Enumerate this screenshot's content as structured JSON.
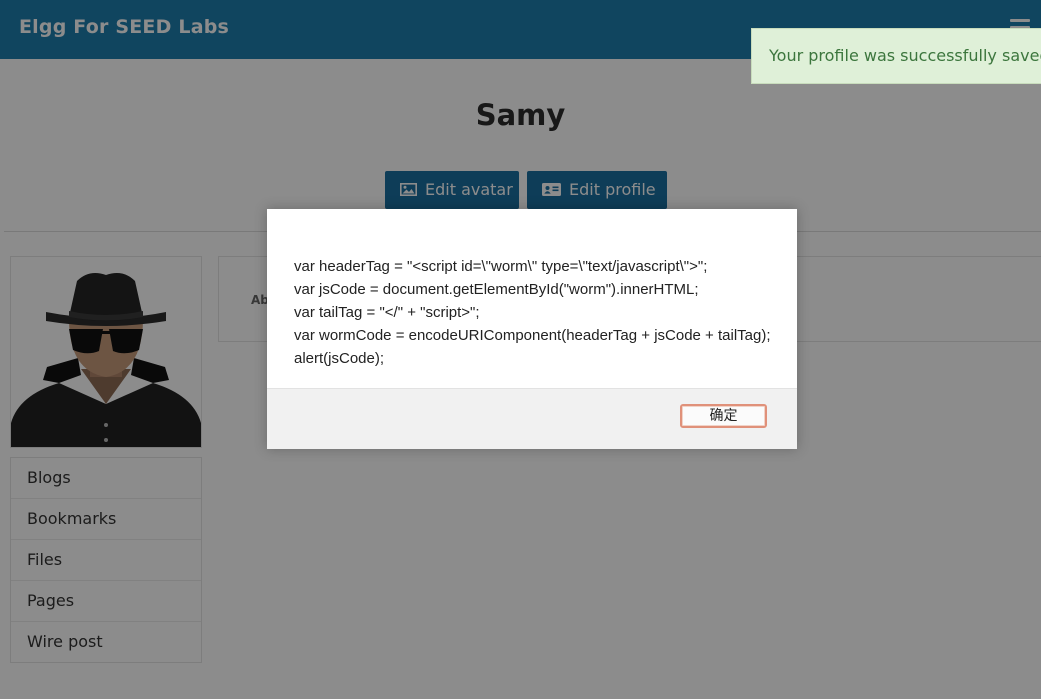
{
  "header": {
    "site_title": "Elgg For SEED Labs",
    "menu_icon": "hamburger-menu-icon"
  },
  "profile": {
    "name": "Samy",
    "edit_avatar_label": "Edit avatar",
    "edit_profile_label": "Edit profile",
    "about_label": "Ab"
  },
  "sidebar": {
    "items": [
      {
        "label": "Blogs"
      },
      {
        "label": "Bookmarks"
      },
      {
        "label": "Files"
      },
      {
        "label": "Pages"
      },
      {
        "label": "Wire post"
      }
    ]
  },
  "notification": {
    "message": "Your profile was successfully saved."
  },
  "dialog": {
    "lines": [
      "var headerTag = \"<script id=\\\"worm\\\" type=\\\"text/javascript\\\">\";",
      "var jsCode = document.getElementById(\"worm\").innerHTML;",
      "var tailTag = \"</\" + \"script>\";",
      "var wormCode = encodeURIComponent(headerTag + jsCode + tailTag);",
      "alert(jsCode);"
    ],
    "ok_label": "确定"
  },
  "colors": {
    "brand": "#1e7fae",
    "button": "#1a6fa0",
    "success_bg": "#dff0d8",
    "success_text": "#3c763d"
  }
}
